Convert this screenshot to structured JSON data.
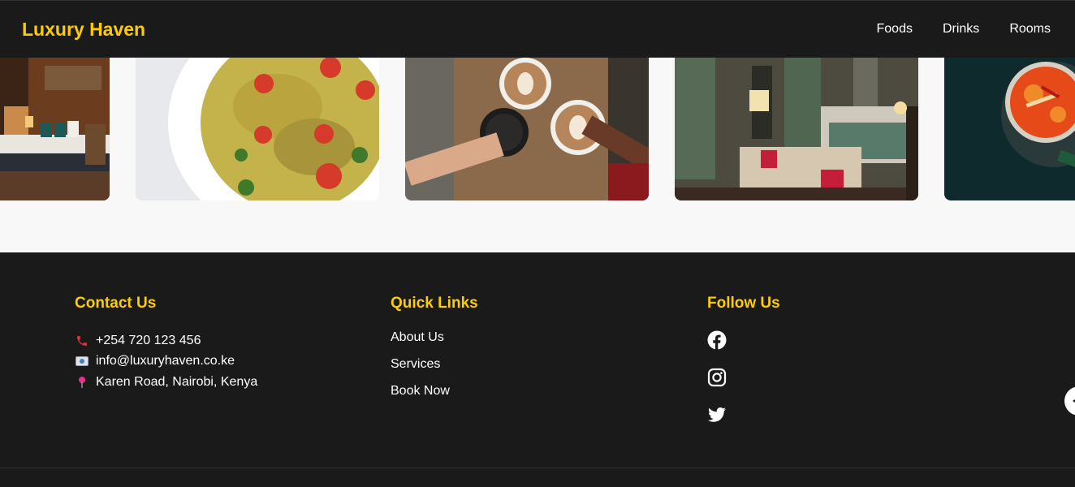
{
  "navbar": {
    "brand": "Luxury Haven",
    "links": [
      {
        "label": "Foods"
      },
      {
        "label": "Drinks"
      },
      {
        "label": "Rooms"
      }
    ]
  },
  "gallery": {
    "images": [
      {
        "subject": "hotel bedroom with wood paneling"
      },
      {
        "subject": "pasta salad with tomatoes"
      },
      {
        "subject": "cappuccino cups cheers"
      },
      {
        "subject": "luxury hotel suite"
      },
      {
        "subject": "soup bowl"
      }
    ]
  },
  "footer": {
    "contact": {
      "heading": "Contact Us",
      "phone": "+254 720 123 456",
      "email": "info@luxuryhaven.co.ke",
      "address": "Karen Road, Nairobi, Kenya"
    },
    "quick_links": {
      "heading": "Quick Links",
      "items": [
        {
          "label": "About Us"
        },
        {
          "label": "Services"
        },
        {
          "label": "Book Now"
        }
      ]
    },
    "follow": {
      "heading": "Follow Us",
      "icons": [
        "facebook-icon",
        "instagram-icon",
        "twitter-icon"
      ]
    }
  },
  "colors": {
    "accent": "#ffcc00",
    "dark": "#1a1a1a",
    "light": "#f8f8f8"
  }
}
